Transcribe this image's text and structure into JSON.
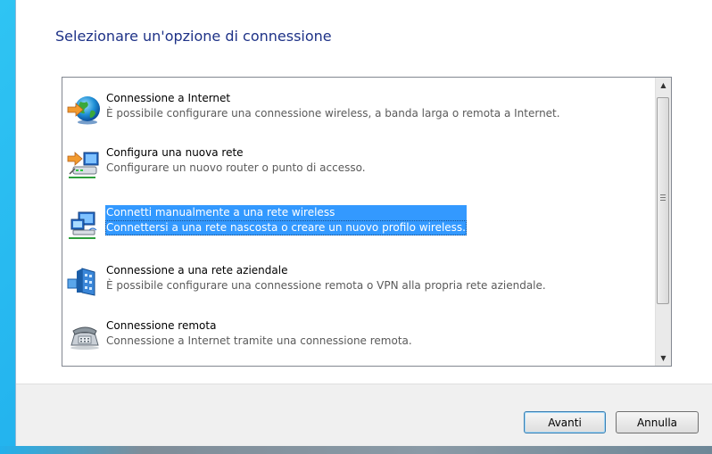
{
  "dialog": {
    "heading": "Selezionare un'opzione di connessione"
  },
  "options": [
    {
      "icon": "globe-internet-icon",
      "title": "Connessione a Internet",
      "description": "È possibile configurare una connessione wireless, a banda larga o remota a Internet.",
      "selected": false
    },
    {
      "icon": "new-network-router-icon",
      "title": "Configura una nuova rete",
      "description": "Configurare un nuovo router o punto di accesso.",
      "selected": false
    },
    {
      "icon": "wireless-network-icon",
      "title": "Connetti manualmente a una rete wireless",
      "description": "Connettersi a una rete nascosta o creare un nuovo profilo wireless.",
      "selected": true
    },
    {
      "icon": "workplace-vpn-icon",
      "title": "Connessione a una rete aziendale",
      "description": "È possibile configurare una connessione remota o VPN alla propria rete aziendale.",
      "selected": false
    },
    {
      "icon": "dialup-phone-icon",
      "title": "Connessione remota",
      "description": "Connessione a Internet tramite una connessione remota.",
      "selected": false
    }
  ],
  "buttons": {
    "next_label": "Avanti",
    "cancel_label": "Annulla"
  },
  "colors": {
    "heading": "#1e3287",
    "selection": "#3399ff"
  }
}
